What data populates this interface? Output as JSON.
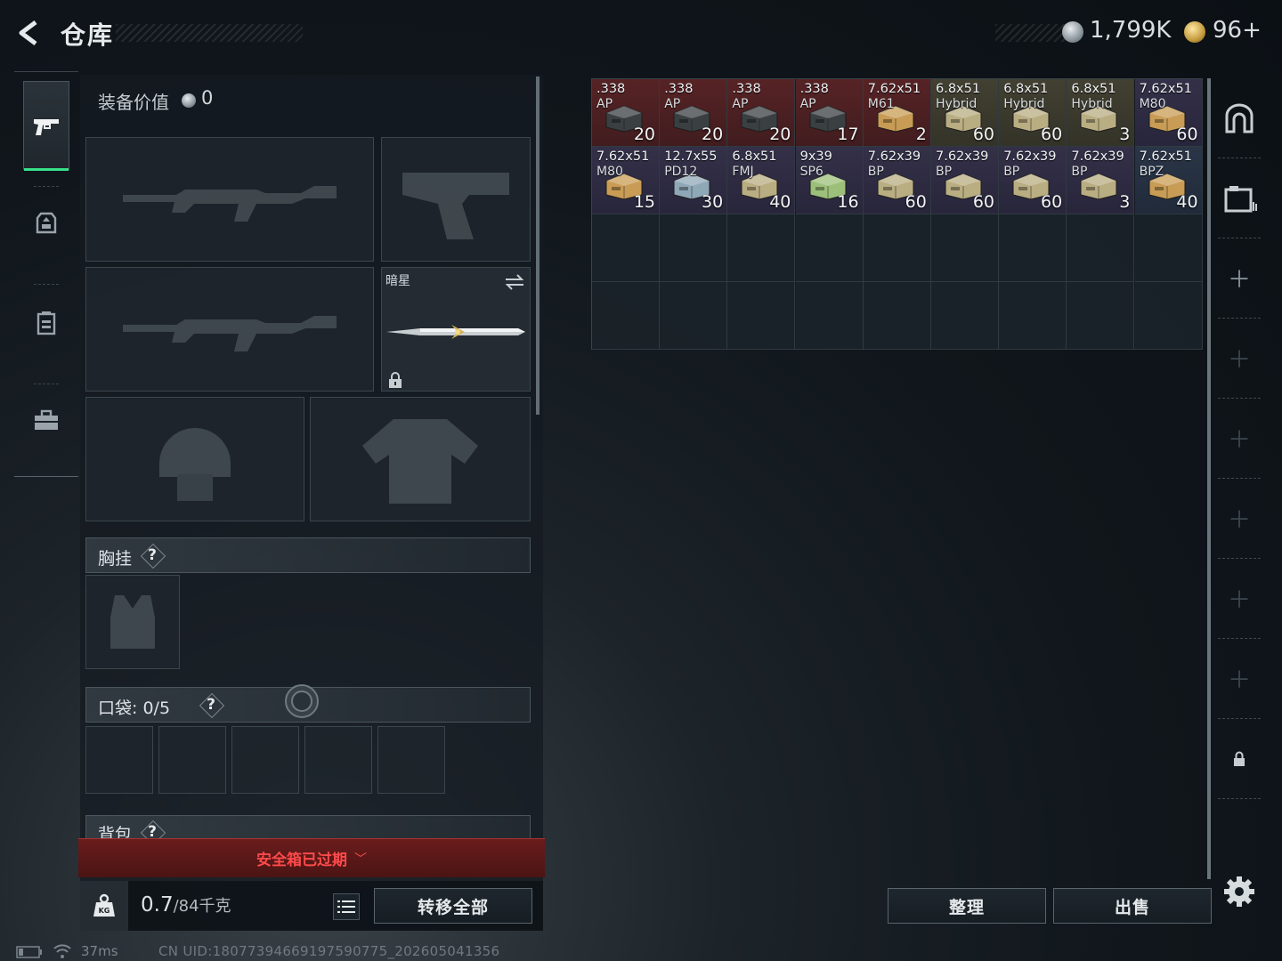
{
  "header": {
    "title": "仓库",
    "silver": "1,799K",
    "gold": "96+"
  },
  "equipment": {
    "value_label": "装备价值",
    "value": "0",
    "melee_name": "暗星",
    "chest_rig_label": "胸挂",
    "pocket_label": "口袋:",
    "pocket_count": "0/5",
    "backpack_label": "背包",
    "help_symbol": "?"
  },
  "safebox": {
    "status": "安全箱已过期"
  },
  "weight": {
    "current": "0.7",
    "max": "/84千克"
  },
  "buttons": {
    "transfer_all": "转移全部",
    "sort": "整理",
    "sell": "出售"
  },
  "inventory": {
    "items": [
      {
        "caliber": ".338",
        "variant": "AP",
        "count": "20",
        "rarity": "red",
        "art": "box-dark",
        "art_color": "#3a3f42"
      },
      {
        "caliber": ".338",
        "variant": "AP",
        "count": "20",
        "rarity": "red",
        "art": "box-dark",
        "art_color": "#3a3f42"
      },
      {
        "caliber": ".338",
        "variant": "AP",
        "count": "20",
        "rarity": "red",
        "art": "box-dark",
        "art_color": "#3a3f42"
      },
      {
        "caliber": ".338",
        "variant": "AP",
        "count": "17",
        "rarity": "red",
        "art": "box-dark",
        "art_color": "#3a3f42"
      },
      {
        "caliber": "7.62x51",
        "variant": "M61",
        "count": "2",
        "rarity": "red",
        "art": "box-tan",
        "art_color": "#c89c55"
      },
      {
        "caliber": "6.8x51",
        "variant": "Hybrid",
        "count": "60",
        "rarity": "yellow",
        "art": "box-khaki",
        "art_color": "#b9ad82"
      },
      {
        "caliber": "6.8x51",
        "variant": "Hybrid",
        "count": "60",
        "rarity": "yellow",
        "art": "box-khaki",
        "art_color": "#b9ad82"
      },
      {
        "caliber": "6.8x51",
        "variant": "Hybrid",
        "count": "3",
        "rarity": "yellow",
        "art": "box-khaki",
        "art_color": "#b9ad82"
      },
      {
        "caliber": "7.62x51",
        "variant": "M80",
        "count": "60",
        "rarity": "purple",
        "art": "box-tan",
        "art_color": "#c89c55"
      },
      {
        "caliber": "7.62x51",
        "variant": "M80",
        "count": "15",
        "rarity": "purple",
        "art": "box-tan",
        "art_color": "#c89c55"
      },
      {
        "caliber": "12.7x55",
        "variant": "PD12",
        "count": "30",
        "rarity": "purple",
        "art": "box-blue",
        "art_color": "#8fa8b8"
      },
      {
        "caliber": "6.8x51",
        "variant": "FMJ",
        "count": "40",
        "rarity": "purple",
        "art": "box-khaki",
        "art_color": "#b9ad82"
      },
      {
        "caliber": "9x39",
        "variant": "SP6",
        "count": "16",
        "rarity": "purple",
        "art": "box-green",
        "art_color": "#9cc07a"
      },
      {
        "caliber": "7.62x39",
        "variant": "BP",
        "count": "60",
        "rarity": "purple",
        "art": "box-khaki",
        "art_color": "#b9ad82"
      },
      {
        "caliber": "7.62x39",
        "variant": "BP",
        "count": "60",
        "rarity": "purple",
        "art": "box-khaki",
        "art_color": "#b9ad82"
      },
      {
        "caliber": "7.62x39",
        "variant": "BP",
        "count": "60",
        "rarity": "purple",
        "art": "box-khaki",
        "art_color": "#b9ad82"
      },
      {
        "caliber": "7.62x39",
        "variant": "BP",
        "count": "3",
        "rarity": "purple",
        "art": "box-khaki",
        "art_color": "#b9ad82"
      },
      {
        "caliber": "7.62x51",
        "variant": "BPZ",
        "count": "40",
        "rarity": "blue",
        "art": "box-tan",
        "art_color": "#c89c55"
      }
    ]
  },
  "status": {
    "ping": "37ms",
    "uid": "CN UID:18077394669197590775_202605041356"
  }
}
